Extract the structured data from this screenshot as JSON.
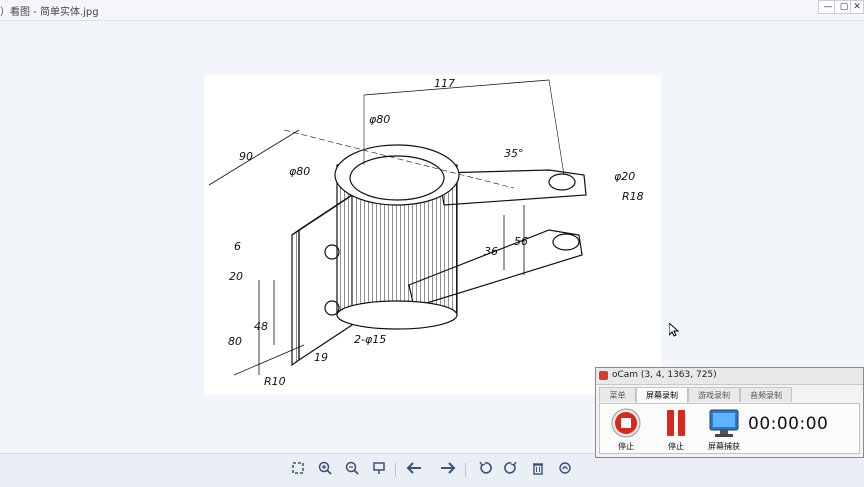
{
  "window": {
    "title": "）看图 - 简单实体.jpg",
    "minimize_label": "—",
    "maximize_label": "▢",
    "close_label": "✕"
  },
  "drawing": {
    "dimensions": [
      "117",
      "90",
      "φ80",
      "φ80",
      "35°",
      "φ20",
      "R18",
      "36",
      "56",
      "6",
      "20",
      "80",
      "48",
      "2-φ15",
      "19",
      "R10"
    ]
  },
  "toolbar": {
    "icons": [
      "fit-screen-icon",
      "zoom-in-icon",
      "zoom-out-icon",
      "slideshow-icon",
      "previous-icon",
      "next-icon",
      "rotate-left-icon",
      "rotate-right-icon",
      "delete-icon",
      "more-icon"
    ]
  },
  "ocam": {
    "title": "oCam (3, 4, 1363, 725)",
    "tabs": [
      "菜单",
      "屏幕录制",
      "游戏录制",
      "音频录制"
    ],
    "active_tab": "屏幕录制",
    "buttons": {
      "stop": "停止",
      "pause": "停止",
      "capture": "屏幕捕获"
    },
    "timer": "00:00:00",
    "colors": {
      "record": "#d8281c",
      "pause": "#d8281c",
      "monitor": "#1e7bd8"
    }
  }
}
